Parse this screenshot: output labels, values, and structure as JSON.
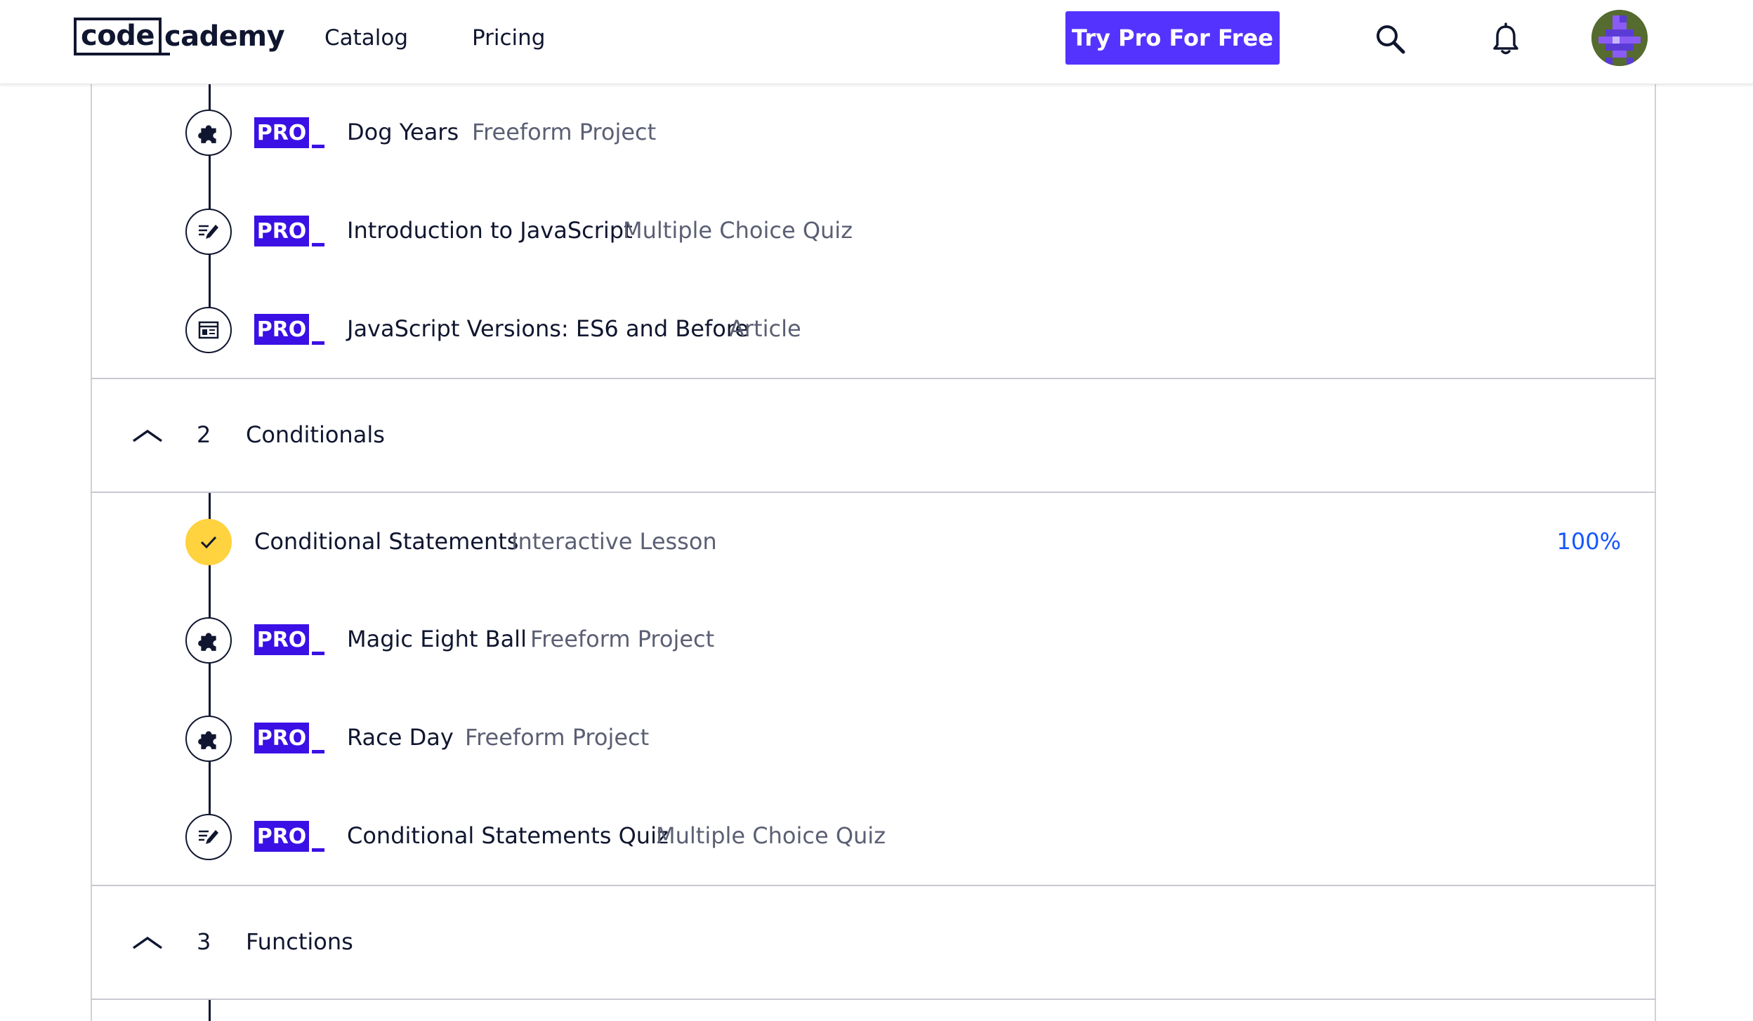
{
  "header": {
    "logo_code": "code",
    "logo_rest": "cademy",
    "nav": [
      "Catalog",
      "Pricing"
    ],
    "cta": "Try Pro For Free",
    "icons": [
      "search-icon",
      "bell-icon",
      "avatar"
    ],
    "brand_color": "#5533ff"
  },
  "pro_label": "PRO",
  "module1_items": [
    {
      "title": "Dog Years",
      "type": "Freeform Project",
      "icon": "puzzle-icon"
    },
    {
      "title": "Introduction to JavaScript",
      "type": "Multiple Choice Quiz",
      "icon": "quiz-icon"
    },
    {
      "title": "JavaScript Versions: ES6 and Before",
      "type": "Article",
      "icon": "article-icon"
    }
  ],
  "module2": {
    "number": "2",
    "title": "Conditionals",
    "items": [
      {
        "title": "Conditional Statements",
        "type": "Interactive Lesson",
        "icon": "check-icon",
        "progress": "100%",
        "completed": true
      },
      {
        "title": "Magic Eight Ball",
        "type": "Freeform Project",
        "icon": "puzzle-icon"
      },
      {
        "title": "Race Day",
        "type": "Freeform Project",
        "icon": "puzzle-icon"
      },
      {
        "title": "Conditional Statements Quiz",
        "type": "Multiple Choice Quiz",
        "icon": "quiz-icon"
      }
    ]
  },
  "module3": {
    "number": "3",
    "title": "Functions"
  },
  "colors": {
    "pro": "#3a10e5",
    "completed": "#ffd23f",
    "progress": "#1557ff"
  }
}
